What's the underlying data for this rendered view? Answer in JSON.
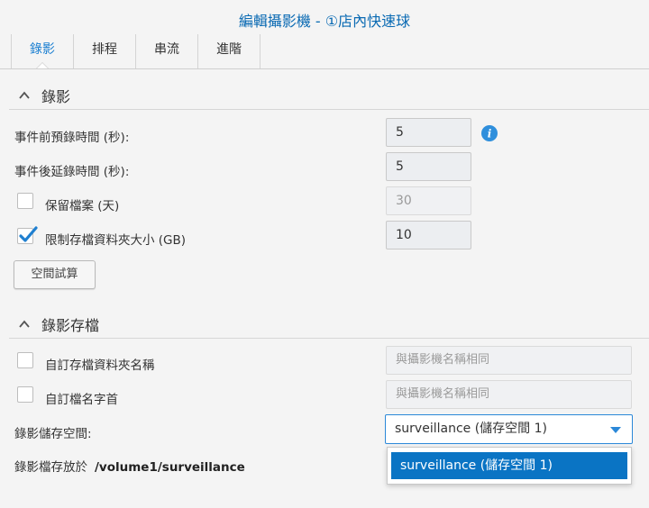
{
  "dialog": {
    "title": "編輯攝影機 - ①店內快速球"
  },
  "tabs": [
    {
      "label": "錄影",
      "active": true
    },
    {
      "label": "排程",
      "active": false
    },
    {
      "label": "串流",
      "active": false
    },
    {
      "label": "進階",
      "active": false
    }
  ],
  "recording": {
    "section_title": "錄影",
    "pre_event_label": "事件前預錄時間 (秒):",
    "pre_event_value": "5",
    "post_event_label": "事件後延錄時間 (秒):",
    "post_event_value": "5",
    "keep_files_label": "保留檔案 (天)",
    "keep_files_checked": false,
    "keep_files_value": "30",
    "limit_folder_label": "限制存檔資料夾大小 (GB)",
    "limit_folder_checked": true,
    "limit_folder_value": "10",
    "estimate_button": "空間試算"
  },
  "archive": {
    "section_title": "錄影存檔",
    "custom_folder_label": "自訂存檔資料夾名稱",
    "custom_folder_checked": false,
    "custom_folder_placeholder": "與攝影機名稱相同",
    "custom_prefix_label": "自訂檔名字首",
    "custom_prefix_checked": false,
    "custom_prefix_placeholder": "與攝影機名稱相同",
    "storage_label": "錄影儲存空間:",
    "storage_selected": "surveillance (儲存空間 1)",
    "storage_options": [
      "surveillance (儲存空間 1)"
    ],
    "path_label": "錄影檔存放於",
    "path_value": "/volume1/surveillance"
  },
  "colors": {
    "accent": "#0a74c4",
    "title": "#0a6ab3",
    "info": "#2f8fdc"
  }
}
